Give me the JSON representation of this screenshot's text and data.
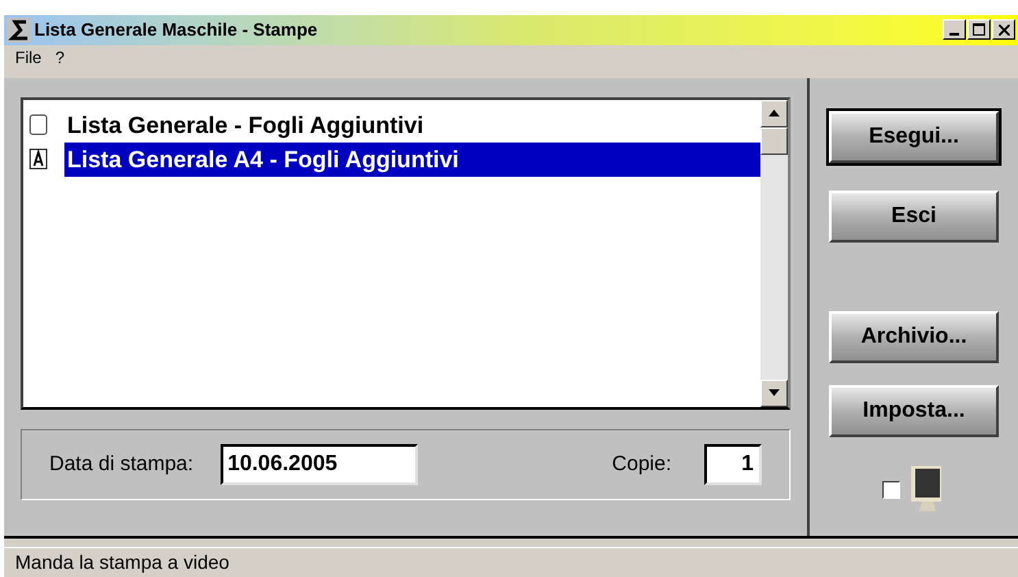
{
  "window": {
    "title": "Lista Generale Maschile - Stampe"
  },
  "menu": [
    "File",
    "?"
  ],
  "list": {
    "items": [
      {
        "label": "Lista Generale - Fogli Aggiuntivi",
        "kind": "blank",
        "selected": false
      },
      {
        "label": "Lista Generale A4 - Fogli Aggiuntivi",
        "kind": "font",
        "selected": true
      }
    ]
  },
  "print_date": {
    "label": "Data di stampa:",
    "value": "10.06.2005"
  },
  "copies": {
    "label": "Copie:",
    "value": "1"
  },
  "buttons": [
    {
      "label": "Esegui...",
      "default": true
    },
    {
      "label": "Esci",
      "default": false
    },
    {
      "label": "Archivio...",
      "default": false
    },
    {
      "label": "Imposta...",
      "default": false
    }
  ],
  "screen_preview": {
    "checked": false
  },
  "status_bar": "Manda la stampa a video"
}
